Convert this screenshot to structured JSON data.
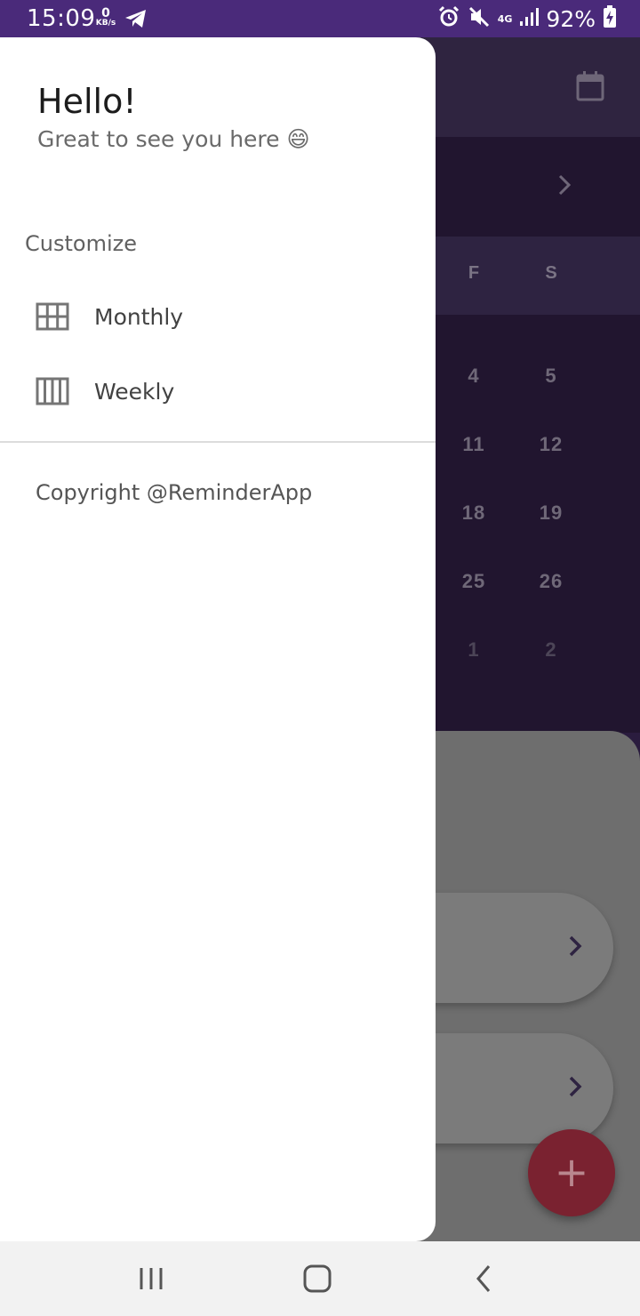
{
  "status_bar": {
    "time": "15:09",
    "net_speed_value": "0",
    "net_speed_unit": "KB/s",
    "network": "4G",
    "battery": "92%",
    "icons": [
      "telegram-icon",
      "alarm-icon",
      "mute-icon",
      "signal-icon",
      "battery-charging-icon"
    ]
  },
  "drawer": {
    "greeting": "Hello!",
    "subtitle": "Great to see you here 😄",
    "section_title": "Customize",
    "items": [
      {
        "label": "Monthly",
        "icon": "grid-icon"
      },
      {
        "label": "Weekly",
        "icon": "columns-icon"
      }
    ],
    "footer": "Copyright @ReminderApp"
  },
  "background_calendar": {
    "weekdays": [
      "F",
      "S"
    ],
    "weeks": [
      [
        "4",
        "5"
      ],
      [
        "11",
        "12"
      ],
      [
        "18",
        "19"
      ],
      [
        "25",
        "26"
      ],
      [
        "1",
        "2"
      ]
    ]
  },
  "fab": {
    "label": "+"
  },
  "colors": {
    "status_bar": "#4a2a7a",
    "drawer_bg": "#ffffff",
    "fab": "#7a2230",
    "scrim": "#6b6b6b"
  }
}
